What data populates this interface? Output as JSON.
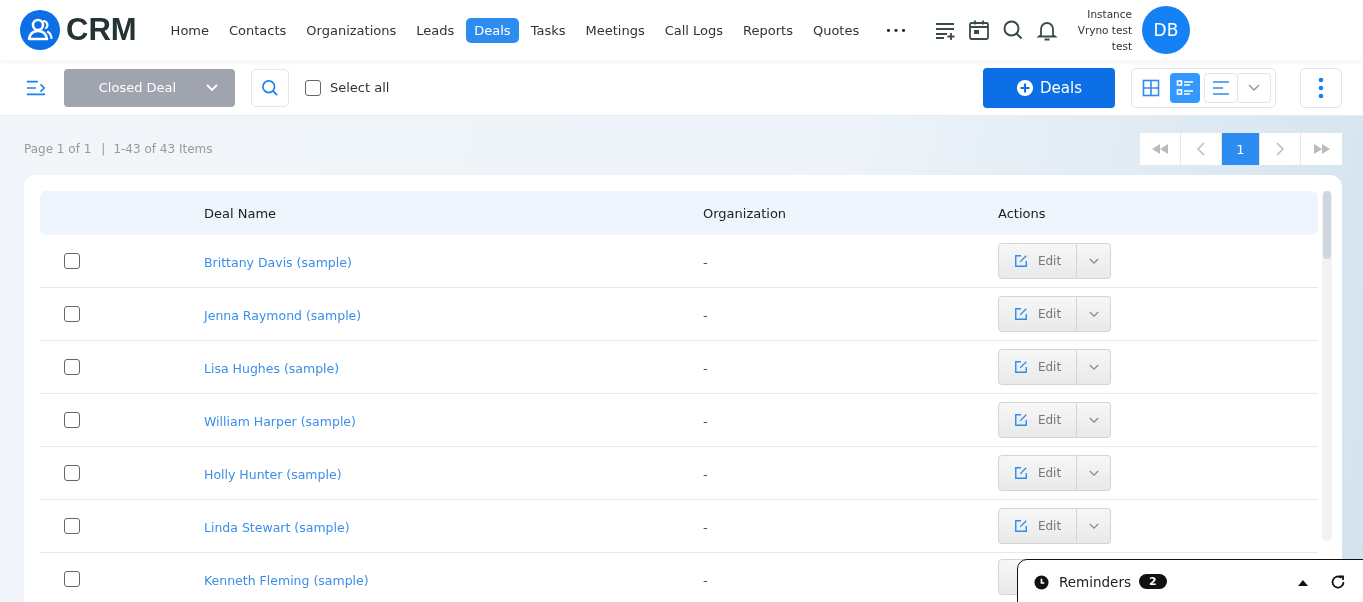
{
  "brand": "CRM",
  "nav": [
    {
      "label": "Home",
      "selected": false
    },
    {
      "label": "Contacts",
      "selected": false
    },
    {
      "label": "Organizations",
      "selected": false
    },
    {
      "label": "Leads",
      "selected": false
    },
    {
      "label": "Deals",
      "selected": true
    },
    {
      "label": "Tasks",
      "selected": false
    },
    {
      "label": "Meetings",
      "selected": false
    },
    {
      "label": "Call Logs",
      "selected": false
    },
    {
      "label": "Reports",
      "selected": false
    },
    {
      "label": "Quotes",
      "selected": false
    }
  ],
  "more": "•••",
  "user": {
    "lines": [
      "Instance",
      "Vryno test",
      "test"
    ],
    "initials": "DB"
  },
  "toolbar": {
    "view_select": "Closed Deal",
    "select_all": {
      "label": "Select all",
      "checked": false
    },
    "add_button": "Deals",
    "views": [
      {
        "kind": "grid",
        "selected": false
      },
      {
        "kind": "list",
        "selected": true
      },
      {
        "kind": "lines",
        "selected": false
      }
    ]
  },
  "pagination": {
    "summary": "Page 1 of 1",
    "separator": "|",
    "range": "1-43 of 43 Items",
    "pages": [
      {
        "label": "1",
        "selected": true
      }
    ]
  },
  "table": {
    "columns": [
      "Deal Name",
      "Organization",
      "Actions"
    ],
    "rows": [
      {
        "checked": false,
        "name": "Brittany Davis (sample)",
        "organization": "-",
        "action": "Edit"
      },
      {
        "checked": false,
        "name": "Jenna Raymond (sample)",
        "organization": "-",
        "action": "Edit"
      },
      {
        "checked": false,
        "name": "Lisa Hughes (sample)",
        "organization": "-",
        "action": "Edit"
      },
      {
        "checked": false,
        "name": "William Harper (sample)",
        "organization": "-",
        "action": "Edit"
      },
      {
        "checked": false,
        "name": "Holly Hunter (sample)",
        "organization": "-",
        "action": "Edit"
      },
      {
        "checked": false,
        "name": "Linda Stewart (sample)",
        "organization": "-",
        "action": "Edit"
      },
      {
        "checked": false,
        "name": "Kenneth Fleming (sample)",
        "organization": "-"
      }
    ]
  },
  "reminders": {
    "label": "Reminders",
    "count": "2"
  }
}
